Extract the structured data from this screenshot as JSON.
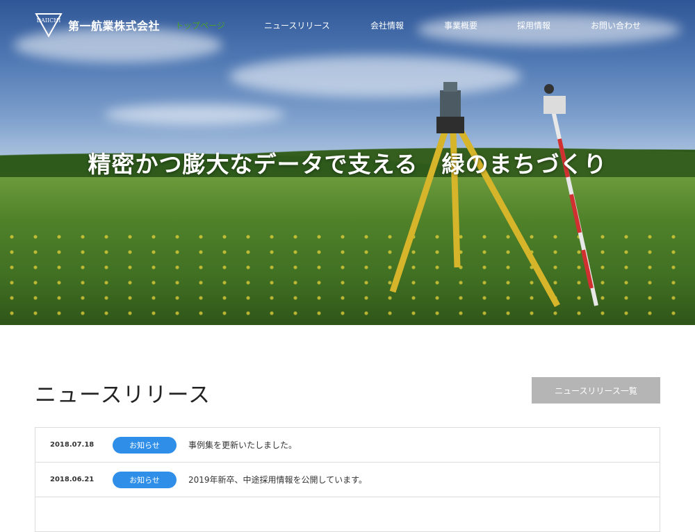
{
  "brand": {
    "logo_text": "DAIICHI",
    "company_name": "第一航業株式会社"
  },
  "nav": {
    "items": [
      {
        "label": "トップページ",
        "active": true
      },
      {
        "label": "ニュースリリース",
        "active": false
      },
      {
        "label": "会社情報",
        "active": false
      },
      {
        "label": "事業概要",
        "active": false
      },
      {
        "label": "採用情報",
        "active": false
      },
      {
        "label": "お問い合わせ",
        "active": false
      }
    ],
    "active_color": "#4aa02a"
  },
  "hero": {
    "title": "精密かつ膨大なデータで支える　緑のまちづくり"
  },
  "news": {
    "heading": "ニュースリリース",
    "all_button": "ニュースリリース一覧",
    "badge_color": "#2f8fe8",
    "items": [
      {
        "date": "2018.07.18",
        "category": "お知らせ",
        "text": "事例集を更新いたしました。"
      },
      {
        "date": "2018.06.21",
        "category": "お知らせ",
        "text": "2019年新卒、中途採用情報を公開しています。"
      }
    ]
  }
}
